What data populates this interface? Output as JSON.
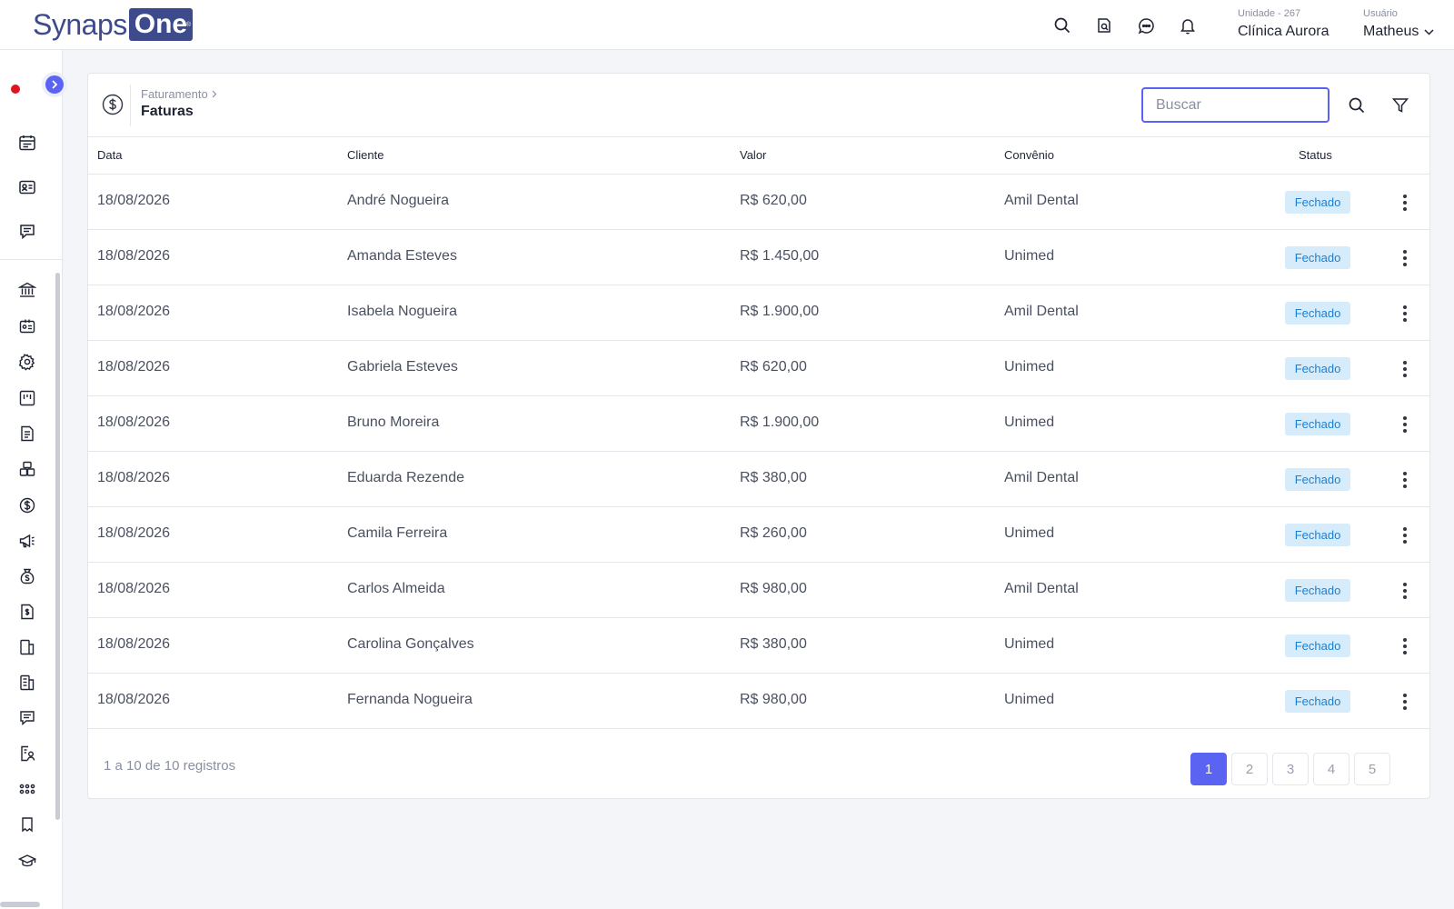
{
  "brand": {
    "name_part1": "Synaps",
    "name_part2": "One",
    "reg": "®"
  },
  "header": {
    "unit_label": "Unidade - 267",
    "unit_name": "Clínica Aurora",
    "user_label": "Usuário",
    "user_name": "Matheus",
    "icons": [
      "search-icon",
      "document-search-icon",
      "chat-icon",
      "bell-icon"
    ]
  },
  "page": {
    "breadcrumb": "Faturamento",
    "title": "Faturas",
    "search_placeholder": "Buscar"
  },
  "table": {
    "columns": [
      "Data",
      "Cliente",
      "Valor",
      "Convênio",
      "Status"
    ],
    "rows": [
      {
        "date": "18/08/2026",
        "client": "André Nogueira",
        "value": "R$ 620,00",
        "plan": "Amil Dental",
        "status": "Fechado"
      },
      {
        "date": "18/08/2026",
        "client": "Amanda Esteves",
        "value": "R$ 1.450,00",
        "plan": "Unimed",
        "status": "Fechado"
      },
      {
        "date": "18/08/2026",
        "client": "Isabela Nogueira",
        "value": "R$ 1.900,00",
        "plan": "Amil Dental",
        "status": "Fechado"
      },
      {
        "date": "18/08/2026",
        "client": "Gabriela Esteves",
        "value": "R$ 620,00",
        "plan": "Unimed",
        "status": "Fechado"
      },
      {
        "date": "18/08/2026",
        "client": "Bruno Moreira",
        "value": "R$ 1.900,00",
        "plan": "Unimed",
        "status": "Fechado"
      },
      {
        "date": "18/08/2026",
        "client": "Eduarda Rezende",
        "value": "R$ 380,00",
        "plan": "Amil Dental",
        "status": "Fechado"
      },
      {
        "date": "18/08/2026",
        "client": "Camila Ferreira",
        "value": "R$ 260,00",
        "plan": "Unimed",
        "status": "Fechado"
      },
      {
        "date": "18/08/2026",
        "client": "Carlos Almeida",
        "value": "R$ 980,00",
        "plan": "Amil Dental",
        "status": "Fechado"
      },
      {
        "date": "18/08/2026",
        "client": "Carolina Gonçalves",
        "value": "R$ 380,00",
        "plan": "Unimed",
        "status": "Fechado"
      },
      {
        "date": "18/08/2026",
        "client": "Fernanda Nogueira",
        "value": "R$ 980,00",
        "plan": "Unimed",
        "status": "Fechado"
      }
    ]
  },
  "footer": {
    "records_text": "1 a 10 de 10 registros",
    "pages": [
      "1",
      "2",
      "3",
      "4",
      "5"
    ],
    "current_page": "1"
  },
  "colors": {
    "accent": "#5b63f2",
    "brand": "#3d4a8c",
    "badge_bg": "#d7ecfb",
    "badge_text": "#1c7fd0",
    "record_dot": "#e0141e"
  },
  "sidebar": {
    "icons": [
      "calendar-icon",
      "id-card-icon",
      "message-icon",
      "bank-icon",
      "patient-card-icon",
      "gear-icon",
      "board-icon",
      "document-icon",
      "inventory-icon",
      "dollar-icon",
      "megaphone-icon",
      "money-bag-icon",
      "file-dollar-icon",
      "building-icon",
      "building-alt-icon",
      "chat-list-icon",
      "clinician-icon",
      "apps-icon",
      "tooth-icon",
      "graduation-cap-icon"
    ]
  }
}
